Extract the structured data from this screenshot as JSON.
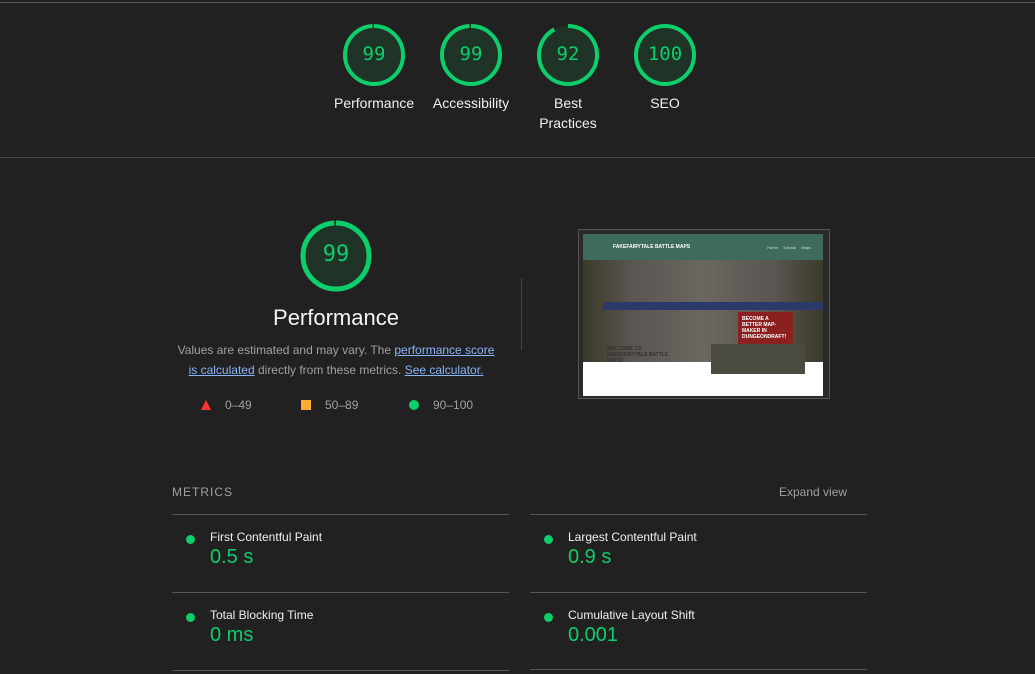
{
  "categories": [
    {
      "label": "Performance",
      "score": 99
    },
    {
      "label": "Accessibility",
      "score": 99
    },
    {
      "label": "Best Practices",
      "score": 92
    },
    {
      "label": "SEO",
      "score": 100
    }
  ],
  "colors": {
    "pass": "#0cce6b",
    "average": "#ffaa33",
    "fail": "#ff3333",
    "background": "#212121"
  },
  "performance": {
    "score": 99,
    "title": "Performance",
    "desc_prefix": "Values are estimated and may vary. The ",
    "link_score": "performance score is calculated",
    "desc_middle": " directly from these metrics. ",
    "link_calc": "See calculator.",
    "legend": [
      {
        "icon": "triangle-icon",
        "range": "0–49"
      },
      {
        "icon": "square-icon",
        "range": "50–89"
      },
      {
        "icon": "circle-icon",
        "range": "90–100"
      }
    ]
  },
  "screenshot": {
    "site_title": "FAKEFAIRYTALE BATTLE MAPS",
    "nav": "Home  Tutorial  Maps",
    "hero_text": "BECOME A BETTER MAP-MAKER IN DUNGEONDRAFT!",
    "welcome": "WELCOME TO FAKEFAIRYTALE BATTLE MAPS!"
  },
  "metrics": {
    "heading": "METRICS",
    "expand": "Expand view",
    "items": [
      {
        "label": "First Contentful Paint",
        "value": "0.5 s"
      },
      {
        "label": "Largest Contentful Paint",
        "value": "0.9 s"
      },
      {
        "label": "Total Blocking Time",
        "value": "0 ms"
      },
      {
        "label": "Cumulative Layout Shift",
        "value": "0.001"
      }
    ]
  }
}
